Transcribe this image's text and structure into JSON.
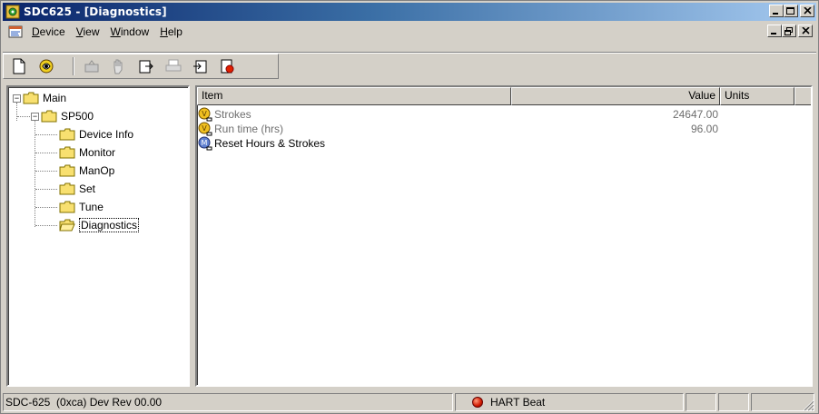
{
  "window": {
    "title": "SDC625 - [Diagnostics]",
    "app_icon": "sdc-app-icon",
    "buttons": [
      "minimize",
      "maximize",
      "close"
    ]
  },
  "menubar": {
    "doc_icon": "document-icon",
    "items": [
      {
        "label": "Device",
        "mnemonic": "D"
      },
      {
        "label": "View",
        "mnemonic": "V"
      },
      {
        "label": "Window",
        "mnemonic": "W"
      },
      {
        "label": "Help",
        "mnemonic": "H"
      }
    ],
    "mdi_buttons": [
      "minimize",
      "restore",
      "close"
    ]
  },
  "toolbar": {
    "buttons": [
      {
        "name": "new-icon",
        "enabled": true
      },
      {
        "name": "connect-icon",
        "enabled": true
      },
      {
        "name": "device-icon",
        "enabled": false
      },
      {
        "name": "hand-icon",
        "enabled": false
      },
      {
        "name": "export-icon",
        "enabled": true
      },
      {
        "name": "print-icon",
        "enabled": false
      },
      {
        "name": "import-icon",
        "enabled": true
      },
      {
        "name": "stop-icon",
        "enabled": true
      }
    ]
  },
  "tree": {
    "root": "Main",
    "device": "SP500",
    "children": [
      "Device Info",
      "Monitor",
      "ManOp",
      "Set",
      "Tune",
      "Diagnostics"
    ],
    "selected": "Diagnostics"
  },
  "list": {
    "columns": [
      "Item",
      "Value",
      "Units"
    ],
    "rows": [
      {
        "icon": "variable-icon",
        "item": "Strokes",
        "value": "24647.00",
        "units": ""
      },
      {
        "icon": "variable-icon",
        "item": "Run time (hrs)",
        "value": "96.00",
        "units": ""
      },
      {
        "icon": "method-icon",
        "item": "Reset Hours & Strokes",
        "value": "",
        "units": ""
      }
    ]
  },
  "statusbar": {
    "device": "SDC-625  (0xca) Dev Rev 00.00",
    "heartbeat": "HART Beat",
    "heartbeat_color": "#d01800"
  }
}
